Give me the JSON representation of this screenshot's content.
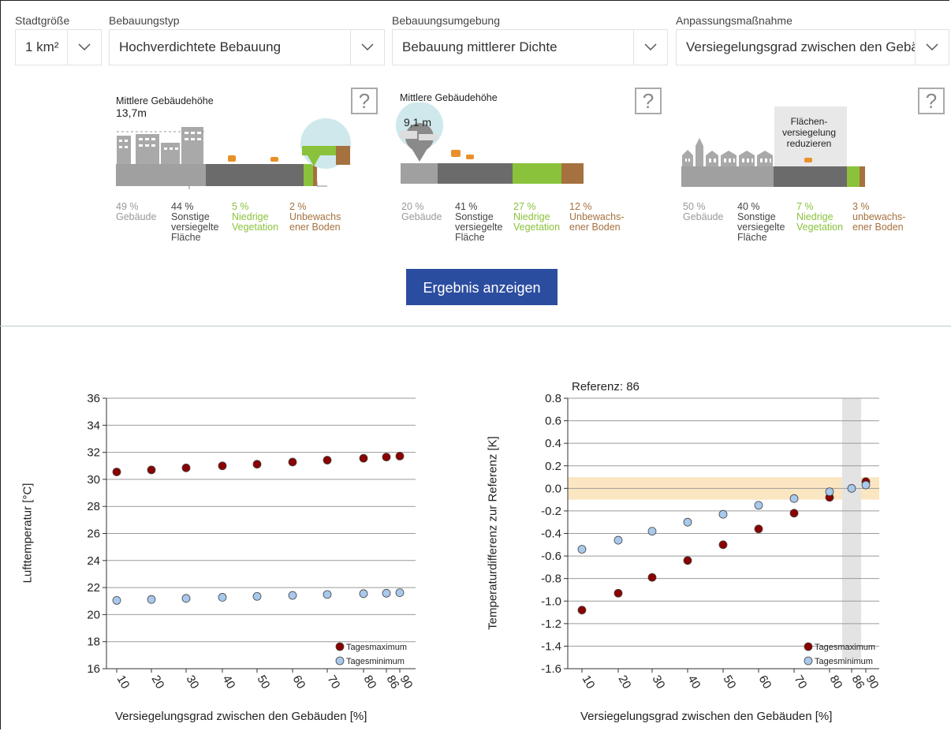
{
  "selectors": [
    {
      "label": "Stadtgröße",
      "value": "1 km²"
    },
    {
      "label": "Bebauungstyp",
      "value": "Hochverdichtete Bebauung"
    },
    {
      "label": "Bebauungsumgebung",
      "value": "Bebauung mittlerer Dichte"
    },
    {
      "label": "Anpassungsmaßnahme",
      "value": "Versiegelungsgrad zwischen den Gebäuden"
    }
  ],
  "help_symbol": "?",
  "panels": [
    {
      "title_line1": "Mittlere Gebäudehöhe",
      "title_line2": "13,7m",
      "items": [
        {
          "pct": "49 %",
          "lines": [
            "Gebäude"
          ]
        },
        {
          "pct": "44 %",
          "lines": [
            "Sonstige",
            "versiegelte",
            "Fläche"
          ]
        },
        {
          "pct": "5 %",
          "lines": [
            "Niedrige",
            "Vegetation"
          ]
        },
        {
          "pct": "2 %",
          "lines": [
            "Unbewachs",
            "ener Boden"
          ]
        }
      ]
    },
    {
      "title_line1": "Mittlere Gebäudehöhe",
      "bubble": "9,1 m",
      "items": [
        {
          "pct": "20 %",
          "lines": [
            "Gebäude"
          ]
        },
        {
          "pct": "41 %",
          "lines": [
            "Sonstige",
            "versiegelte",
            "Fläche"
          ]
        },
        {
          "pct": "27 %",
          "lines": [
            "Niedrige",
            "Vegetation"
          ]
        },
        {
          "pct": "12 %",
          "lines": [
            "Unbewachs-",
            "ener Boden"
          ]
        }
      ]
    },
    {
      "callout": [
        "Flächen-",
        "versiegelung",
        "reduzieren"
      ],
      "items": [
        {
          "pct": "50 %",
          "lines": [
            "Gebäude"
          ]
        },
        {
          "pct": "40 %",
          "lines": [
            "Sonstige",
            "versiegelte",
            "Fläche"
          ]
        },
        {
          "pct": "7 %",
          "lines": [
            "Niedrige",
            "Vegetation"
          ]
        },
        {
          "pct": "3 %",
          "lines": [
            "unbewachs-",
            "ener Boden"
          ]
        }
      ]
    }
  ],
  "result_button": "Ergebnis anzeigen",
  "colors": {
    "building": "#a0a0a0",
    "sealed": "#6b6b6b",
    "vegetation": "#8ac23b",
    "soil": "#a5713f",
    "button": "#2b4da0",
    "max": "#8b0000",
    "min": "#a8c8ec",
    "band": "#fbe6c2"
  },
  "chart_data": [
    {
      "type": "scatter",
      "xlabel": "Versiegelungsgrad zwischen den Gebäuden [%]",
      "ylabel": "Lufttemperatur [°C]",
      "x_ticks": [
        "10",
        "20",
        "30",
        "40",
        "50",
        "60",
        "70",
        "80",
        "86",
        "90"
      ],
      "ylim": [
        16,
        36
      ],
      "y_ticks": [
        16,
        18,
        20,
        22,
        24,
        26,
        28,
        30,
        32,
        34,
        36
      ],
      "legend_position": "bottom-right",
      "series": [
        {
          "name": "Tagesmaximum",
          "color": "#8b0000",
          "x": [
            10,
            20,
            30,
            40,
            50,
            60,
            70,
            80,
            86,
            90
          ],
          "y": [
            30.55,
            30.7,
            30.85,
            31.0,
            31.12,
            31.28,
            31.42,
            31.56,
            31.65,
            31.72
          ]
        },
        {
          "name": "Tagesminimum",
          "color": "#a8c8ec",
          "x": [
            10,
            20,
            30,
            40,
            50,
            60,
            70,
            80,
            86,
            90
          ],
          "y": [
            21.05,
            21.12,
            21.2,
            21.28,
            21.35,
            21.42,
            21.49,
            21.55,
            21.58,
            21.62
          ]
        }
      ]
    },
    {
      "type": "scatter",
      "title": "Referenz: 86",
      "xlabel": "Versiegelungsgrad zwischen den Gebäuden [%]",
      "ylabel": "Temperaturdifferenz zur Referenz [K]",
      "x_ticks": [
        "10",
        "20",
        "30",
        "40",
        "50",
        "60",
        "70",
        "80",
        "86",
        "90"
      ],
      "ylim": [
        -1.6,
        0.8
      ],
      "y_ticks": [
        "0.8",
        "0.6",
        "0.4",
        "0.2",
        "0.0",
        "-0.2",
        "-0.4",
        "-0.6",
        "-0.8",
        "-1.0",
        "-1.2",
        "-1.4",
        "-1.6"
      ],
      "reference_x": 86,
      "band": [
        -0.1,
        0.1
      ],
      "legend_position": "bottom-right",
      "series": [
        {
          "name": "Tagesmaximum",
          "color": "#8b0000",
          "x": [
            10,
            20,
            30,
            40,
            50,
            60,
            70,
            80,
            90
          ],
          "y": [
            -1.08,
            -0.93,
            -0.79,
            -0.64,
            -0.5,
            -0.36,
            -0.22,
            -0.08,
            0.06
          ]
        },
        {
          "name": "Tagesminimum",
          "color": "#a8c8ec",
          "x": [
            10,
            20,
            30,
            40,
            50,
            60,
            70,
            80,
            86,
            90
          ],
          "y": [
            -0.54,
            -0.46,
            -0.38,
            -0.3,
            -0.23,
            -0.15,
            -0.09,
            -0.03,
            0.0,
            0.03
          ]
        }
      ]
    }
  ]
}
